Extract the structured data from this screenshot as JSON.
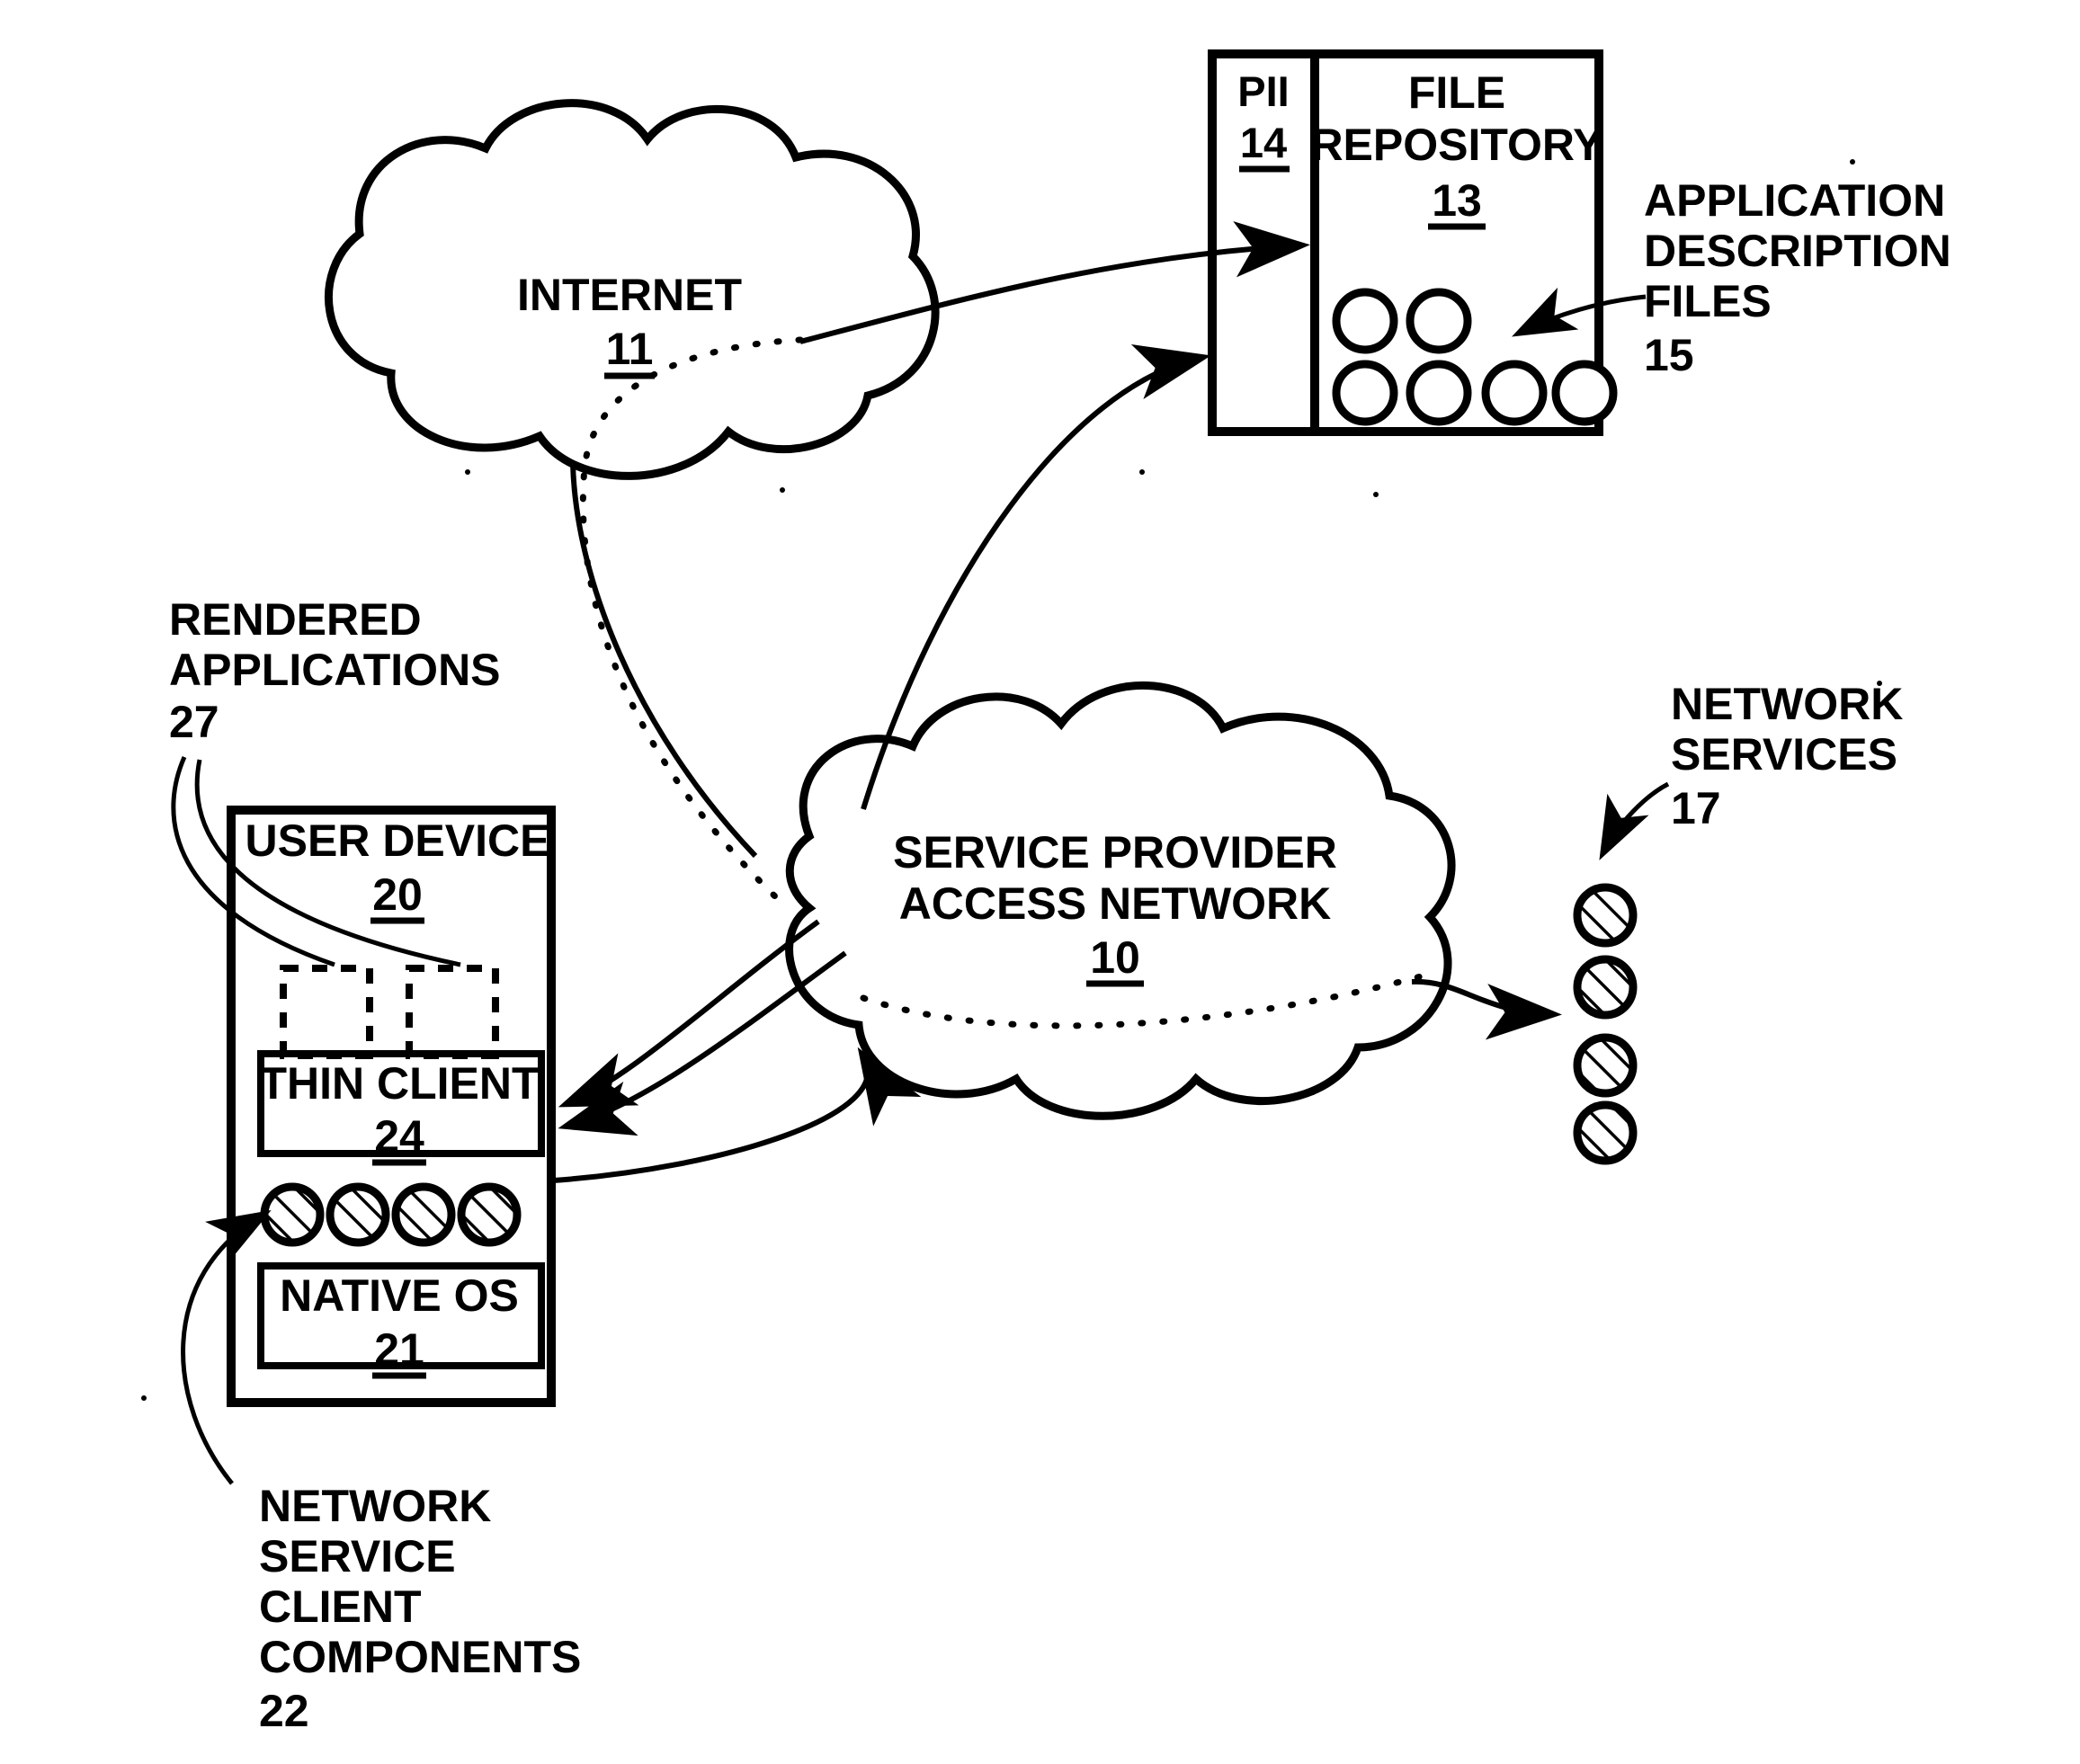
{
  "figure": {
    "title": "Network application delivery architecture diagram",
    "style": "patent line drawing, black on white"
  },
  "nodes": {
    "internet": {
      "label": "INTERNET",
      "ref": "11",
      "shape": "cloud"
    },
    "file_repository": {
      "label_line1": "FILE",
      "label_line2": "REPOSITORY",
      "ref": "13",
      "shape": "box"
    },
    "pii": {
      "label": "PII",
      "ref": "14",
      "shape": "box-panel"
    },
    "service_provider": {
      "label_line1": "SERVICE PROVIDER",
      "label_line2": "ACCESS NETWORK",
      "ref": "10",
      "shape": "cloud"
    },
    "user_device": {
      "label": "USER DEVICE",
      "ref": "20",
      "shape": "box"
    },
    "thin_client": {
      "label": "THIN CLIENT",
      "ref": "24",
      "shape": "box"
    },
    "native_os": {
      "label": "NATIVE OS",
      "ref": "21",
      "shape": "box"
    }
  },
  "callouts": {
    "application_description_files": {
      "line1": "APPLICATION",
      "line2": "DESCRIPTION",
      "line3": "FILES",
      "ref": "15"
    },
    "network_services": {
      "line1": "NETWORK",
      "line2": "SERVICES",
      "ref": "17"
    },
    "rendered_applications": {
      "line1": "RENDERED",
      "line2": "APPLICATIONS",
      "ref": "27"
    },
    "network_service_client_components": {
      "line1": "NETWORK",
      "line2": "SERVICE",
      "line3": "CLIENT",
      "line4": "COMPONENTS",
      "ref": "22"
    }
  },
  "glyphs": {
    "repository_files_count": 6,
    "device_service_components_count": 4,
    "network_services_count": 4,
    "rendered_app_placeholders_count": 2
  },
  "colors": {
    "ink": "#000000",
    "paper": "#ffffff"
  }
}
